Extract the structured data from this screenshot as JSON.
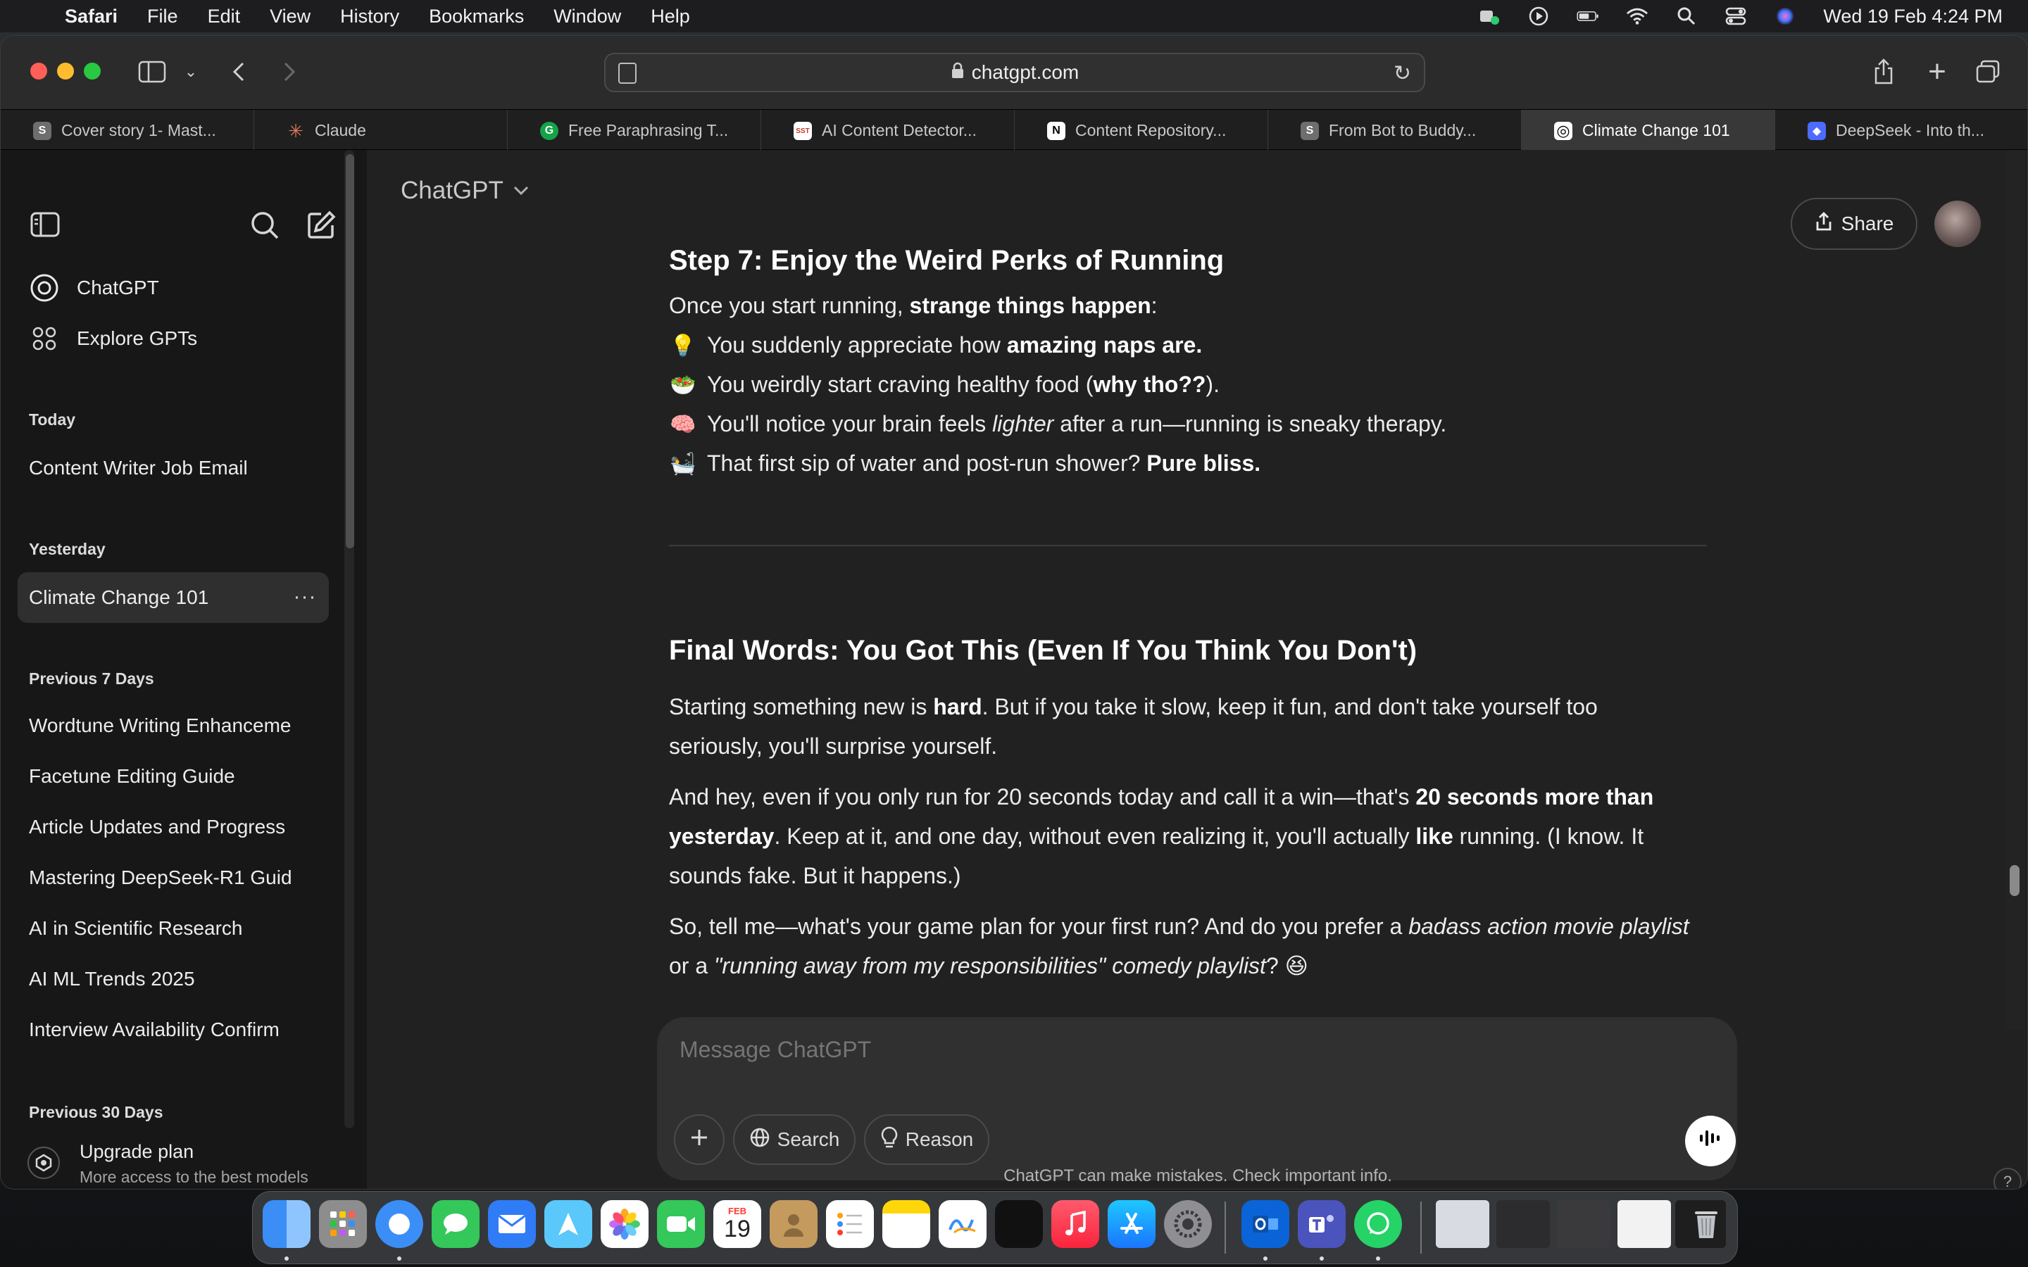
{
  "menubar": {
    "app": "Safari",
    "items": [
      "File",
      "Edit",
      "View",
      "History",
      "Bookmarks",
      "Window",
      "Help"
    ],
    "datetime": "Wed 19 Feb  4:24 PM"
  },
  "browser": {
    "url": "chatgpt.com",
    "tabs": [
      {
        "label": "Cover story 1- Mast...",
        "fav": "S",
        "color": "#6e6e6e"
      },
      {
        "label": "Claude",
        "fav": "✳",
        "color": "#d97757"
      },
      {
        "label": "Free Paraphrasing T...",
        "fav": "G",
        "color": "#15a34a"
      },
      {
        "label": "AI Content Detector...",
        "fav": "SST",
        "color": "#ffffff"
      },
      {
        "label": "Content Repository...",
        "fav": "N",
        "color": "#ffffff"
      },
      {
        "label": "From Bot to Buddy...",
        "fav": "S",
        "color": "#6e6e6e"
      },
      {
        "label": "Climate Change 101",
        "fav": "◎",
        "color": "#ffffff"
      },
      {
        "label": "DeepSeek - Into th...",
        "fav": "◆",
        "color": "#4d6bfe"
      }
    ]
  },
  "sidebar": {
    "top": [
      {
        "label": "ChatGPT",
        "icon": "openai-icon"
      },
      {
        "label": "Explore GPTs",
        "icon": "grid-icon"
      }
    ],
    "sections": [
      {
        "heading": "Today",
        "items": [
          "Content Writer Job Email"
        ]
      },
      {
        "heading": "Yesterday",
        "items": [
          "Climate Change 101"
        ]
      },
      {
        "heading": "Previous 7 Days",
        "items": [
          "Wordtune Writing Enhanceme",
          "Facetune Editing Guide",
          "Article Updates and Progress",
          "Mastering DeepSeek-R1 Guid",
          "AI in Scientific Research",
          "AI ML Trends 2025",
          "Interview Availability Confirm"
        ]
      },
      {
        "heading": "Previous 30 Days",
        "items": []
      }
    ],
    "upgrade": {
      "title": "Upgrade plan",
      "subtitle": "More access to the best models"
    }
  },
  "header": {
    "model": "ChatGPT",
    "share": "Share"
  },
  "message": {
    "step7_title": "Step 7: Enjoy the Weird Perks of Running",
    "step7_intro_a": "Once you start running, ",
    "step7_intro_b": "strange things happen",
    "step7_intro_c": ":",
    "perks": [
      {
        "emoji": "💡",
        "a": "You suddenly appreciate how ",
        "b": "amazing naps are.",
        "c": ""
      },
      {
        "emoji": "🥗",
        "a": "You weirdly start craving healthy food (",
        "b": "why tho??",
        "c": ")."
      },
      {
        "emoji": "🧠",
        "a": "You'll notice your brain feels ",
        "i": "lighter",
        "c": " after a run—running is sneaky therapy."
      },
      {
        "emoji": "🛀",
        "a": "That first sip of water and post-run shower? ",
        "b": "Pure bliss.",
        "c": ""
      }
    ],
    "final_title": "Final Words: You Got This (Even If You Think You Don't)",
    "p1_a": "Starting something new is ",
    "p1_b": "hard",
    "p1_c": ". But if you take it slow, keep it fun, and don't take yourself too",
    "p1_d": "seriously, you'll surprise yourself.",
    "p2_a": "And hey, even if you only run for 20 seconds today and call it a win—that's ",
    "p2_b": "20 seconds more than",
    "p2_c": "yesterday",
    "p2_d": ". Keep at it, and one day, without even realizing it, you'll actually ",
    "p2_e": "like",
    "p2_f": " running. (I know. It",
    "p2_g": "sounds fake. But it happens.)",
    "p3_a": "So, tell me—what's your game plan for your first run? And do you prefer a ",
    "p3_b": "badass action movie playlist",
    "p3_c": "or a ",
    "p3_d": "\"running away from my responsibilities\" comedy playlist",
    "p3_e": "? 😆"
  },
  "composer": {
    "placeholder": "Message ChatGPT",
    "search": "Search",
    "reason": "Reason"
  },
  "disclaimer": "ChatGPT can make mistakes. Check important info.",
  "dock": {
    "calendar_month": "FEB",
    "calendar_day": "19"
  }
}
